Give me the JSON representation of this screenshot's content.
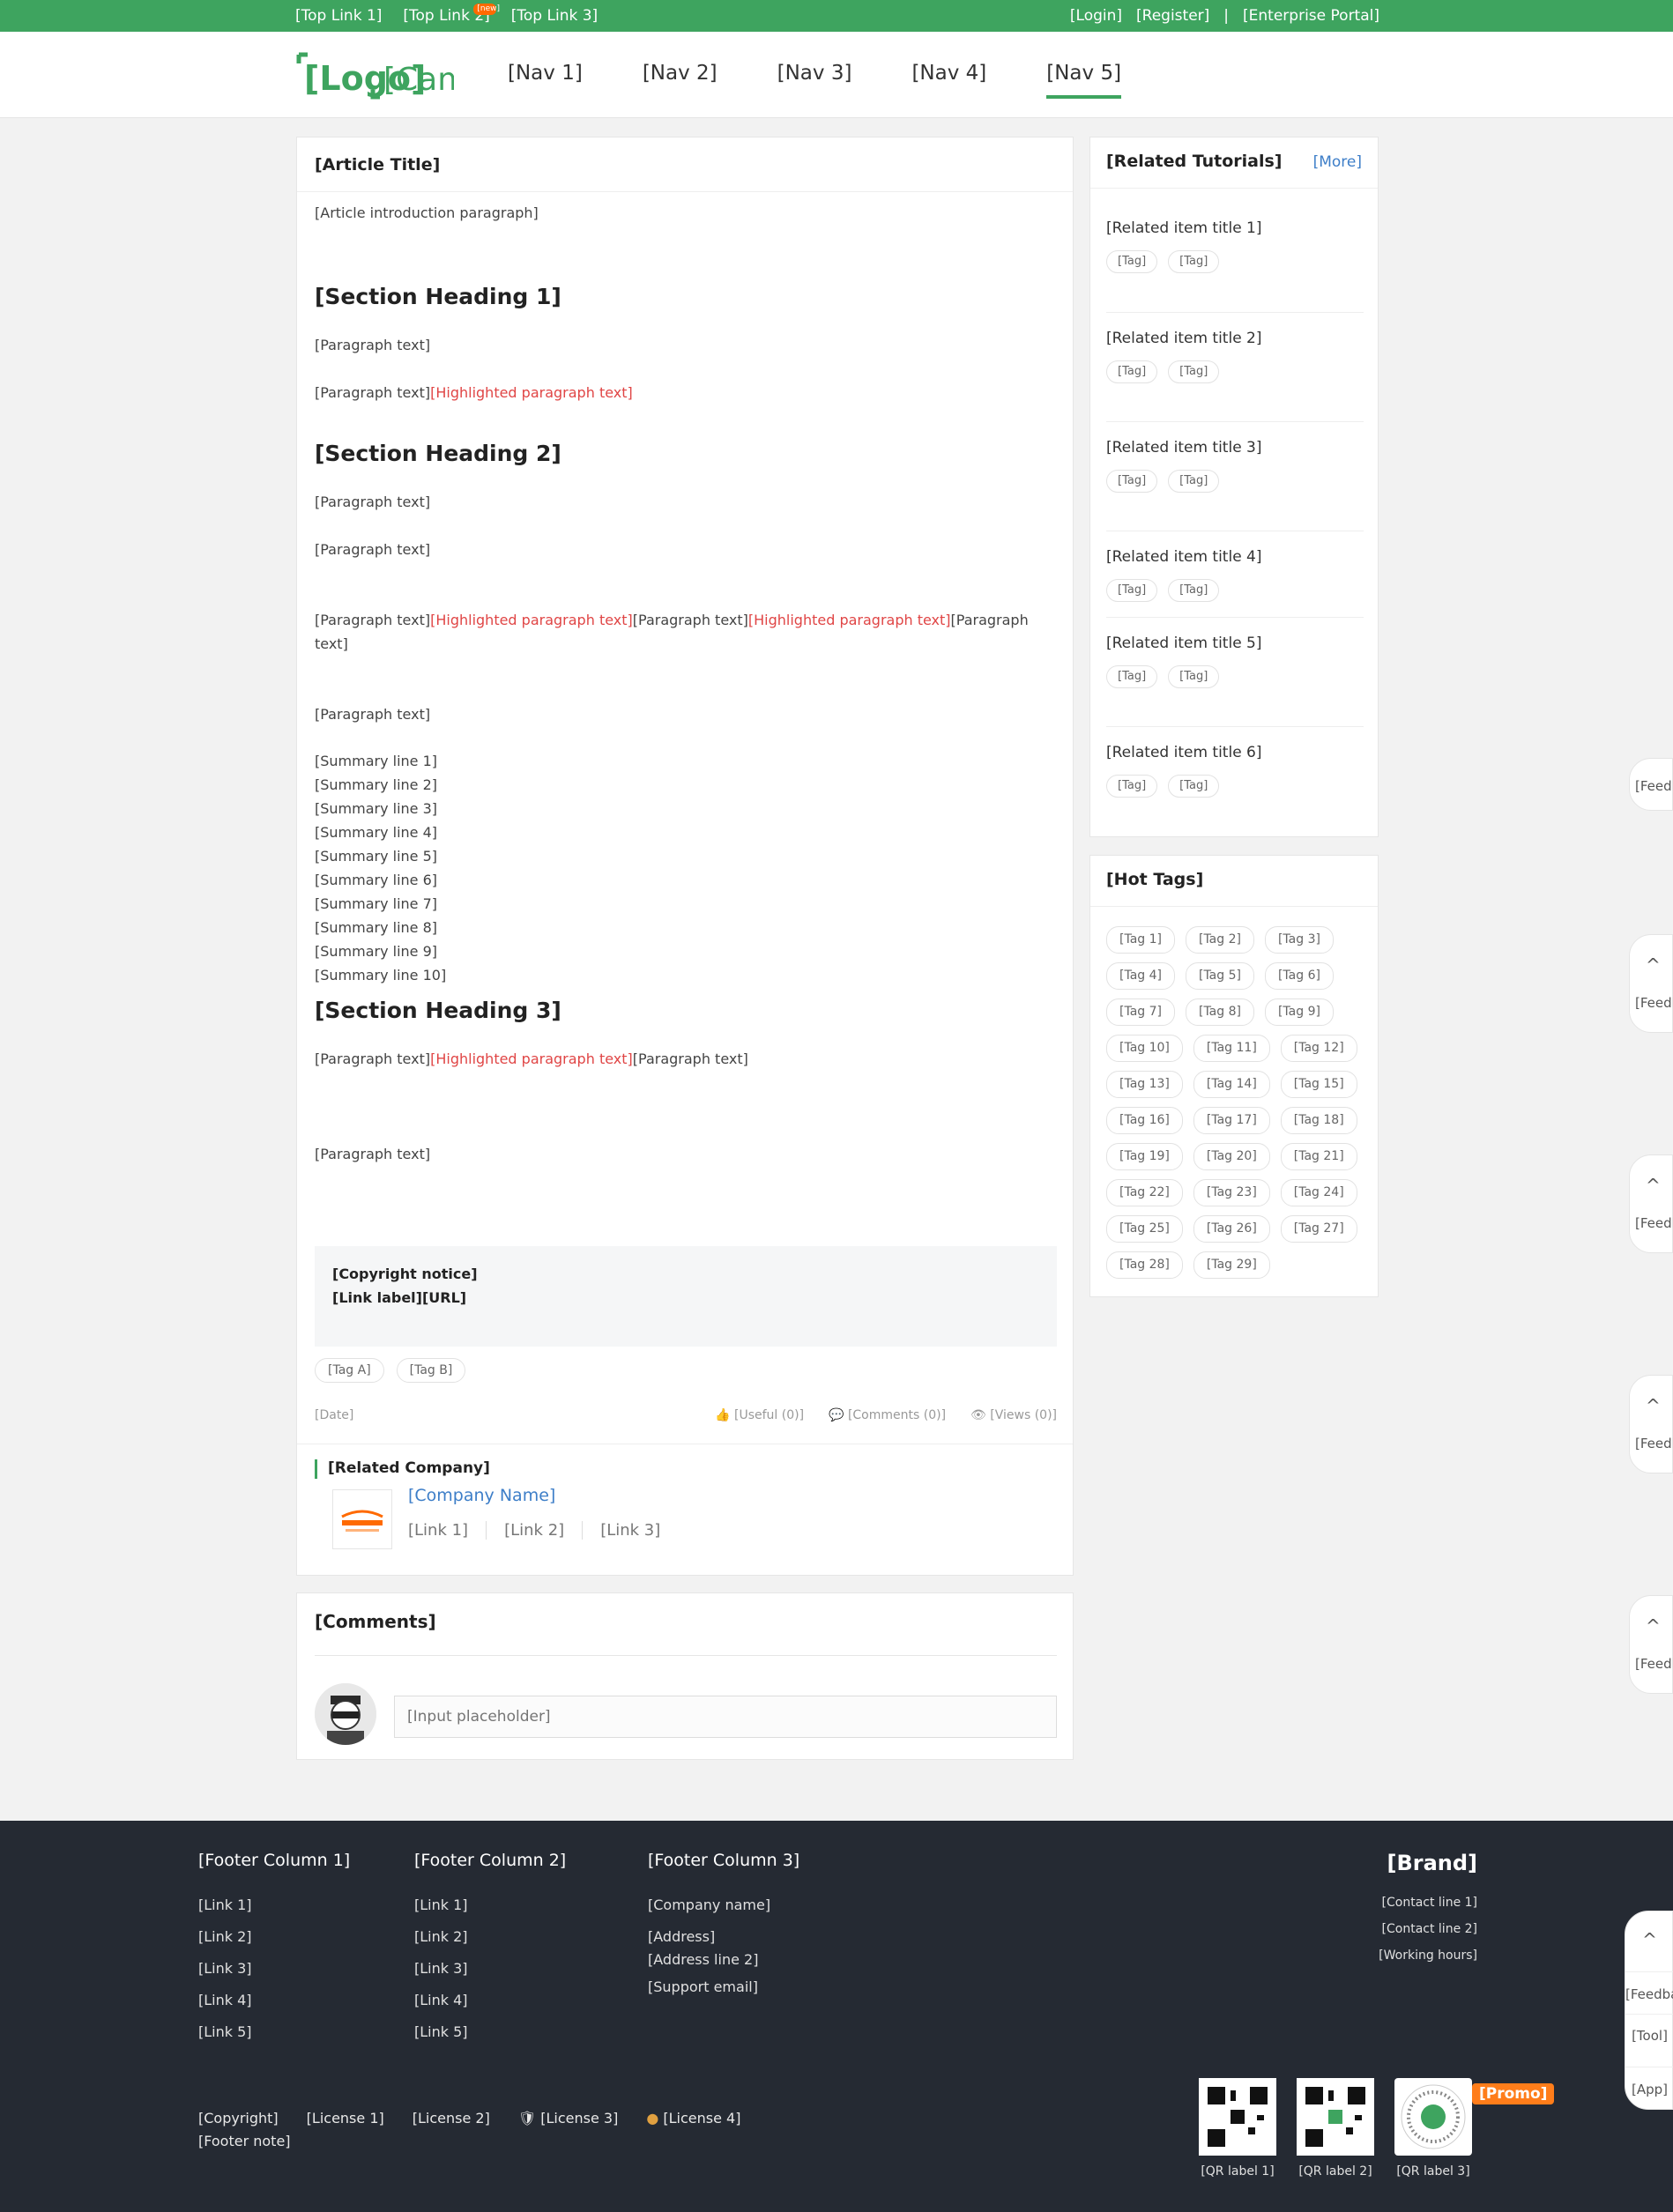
{
  "topbar": {
    "links": [
      "[Top Link 1]",
      "[Top Link 2]",
      "[Top Link 3]"
    ],
    "badge": "[new]",
    "right": [
      "[Login]",
      "[Register]",
      "[Enterprise Portal]"
    ]
  },
  "header": {
    "logo_main": "[Logo]",
    "logo_sub": "[Campus]",
    "nav": [
      "[Nav 1]",
      "[Nav 2]",
      "[Nav 3]",
      "[Nav 4]",
      "[Nav 5]"
    ]
  },
  "article": {
    "title": "[Article Title]",
    "intro": "[Article introduction paragraph]",
    "h1": "[Section Heading 1]",
    "p1": "[Paragraph text]",
    "p2a": "[Paragraph text]",
    "p2b": "[Highlighted paragraph text]",
    "h2": "[Section Heading 2]",
    "p3": "[Paragraph text]",
    "p4": "[Paragraph text]",
    "p5a": "[Paragraph text]",
    "p5b": "[Highlighted paragraph text]",
    "p5c": "[Paragraph text]",
    "p5d": "[Highlighted paragraph text]",
    "p5e": "[Paragraph text]",
    "p6": "[Paragraph text]",
    "summary": [
      "[Summary line 1]",
      "[Summary line 2]",
      "[Summary line 3]",
      "[Summary line 4]",
      "[Summary line 5]",
      "[Summary line 6]",
      "[Summary line 7]",
      "[Summary line 8]",
      "[Summary line 9]",
      "[Summary line 10]"
    ],
    "h3": "[Section Heading 3]",
    "p7a": "[Paragraph text]",
    "p7b": "[Highlighted paragraph text]",
    "p7c": "[Paragraph text]",
    "p8": "[Paragraph text]",
    "copyright": "[Copyright notice]",
    "copyright_link_label": "[Link label]",
    "copyright_link": "[URL]",
    "tags": [
      "[Tag A]",
      "[Tag B]"
    ],
    "date": "[Date]",
    "useful": "[Useful (0)]",
    "comment": "[Comments (0)]",
    "views": "[Views (0)]",
    "company_heading": "[Related Company]",
    "company_name": "[Company Name]",
    "company_links": [
      "[Link 1]",
      "[Link 2]",
      "[Link 3]"
    ]
  },
  "comments": {
    "title": "[Comments]",
    "placeholder": "[Input placeholder]"
  },
  "related": {
    "title": "[Related Tutorials]",
    "more": "[More]",
    "items": [
      {
        "title": "[Related item title 1]",
        "tags": [
          "[Tag]",
          "[Tag]"
        ]
      },
      {
        "title": "[Related item title 2]",
        "tags": [
          "[Tag]",
          "[Tag]"
        ]
      },
      {
        "title": "[Related item title 3]",
        "tags": [
          "[Tag]",
          "[Tag]"
        ]
      },
      {
        "title": "[Related item title 4]",
        "tags": [
          "[Tag]",
          "[Tag]"
        ]
      },
      {
        "title": "[Related item title 5]",
        "tags": [
          "[Tag]",
          "[Tag]"
        ]
      },
      {
        "title": "[Related item title 6]",
        "tags": [
          "[Tag]",
          "[Tag]"
        ]
      }
    ]
  },
  "hot_tags": {
    "title": "[Hot Tags]",
    "tags": [
      "[Tag 1]",
      "[Tag 2]",
      "[Tag 3]",
      "[Tag 4]",
      "[Tag 5]",
      "[Tag 6]",
      "[Tag 7]",
      "[Tag 8]",
      "[Tag 9]",
      "[Tag 10]",
      "[Tag 11]",
      "[Tag 12]",
      "[Tag 13]",
      "[Tag 14]",
      "[Tag 15]",
      "[Tag 16]",
      "[Tag 17]",
      "[Tag 18]",
      "[Tag 19]",
      "[Tag 20]",
      "[Tag 21]",
      "[Tag 22]",
      "[Tag 23]",
      "[Tag 24]",
      "[Tag 25]",
      "[Tag 26]",
      "[Tag 27]",
      "[Tag 28]",
      "[Tag 29]"
    ]
  },
  "float": {
    "up": "^",
    "feedback": "[Feedback]"
  },
  "sidebar": {
    "up": "^",
    "feedback": "[Feedback]",
    "calc": "[Tool]",
    "app": "[App]"
  },
  "footer": {
    "col1": {
      "title": "[Footer Column 1]",
      "items": [
        "[Link 1]",
        "[Link 2]",
        "[Link 3]",
        "[Link 4]",
        "[Link 5]"
      ]
    },
    "col2": {
      "title": "[Footer Column 2]",
      "items": [
        "[Link 1]",
        "[Link 2]",
        "[Link 3]",
        "[Link 4]",
        "[Link 5]"
      ]
    },
    "col3": {
      "title": "[Footer Column 3]",
      "items": [
        "[Company name]",
        "[Address]",
        "[Address line 2]",
        "[Support email]"
      ]
    },
    "brand": "[Brand]",
    "right": [
      "[Contact line 1]",
      "[Contact line 2]",
      "[Working hours]"
    ],
    "bottom_row": [
      "[Copyright]",
      "[License 1]",
      "[License 2]",
      "[License 3]",
      "[License 4]"
    ],
    "bottom_line2": "[Footer note]",
    "qr_labels": [
      "[QR label 1]",
      "[QR label 2]",
      "[QR label 3]"
    ],
    "promo": "[Promo]"
  },
  "colors": {
    "accent": "#3ea45f",
    "link": "#3d7ec8",
    "highlight": "#e04545",
    "footer_bg": "#252a33"
  }
}
